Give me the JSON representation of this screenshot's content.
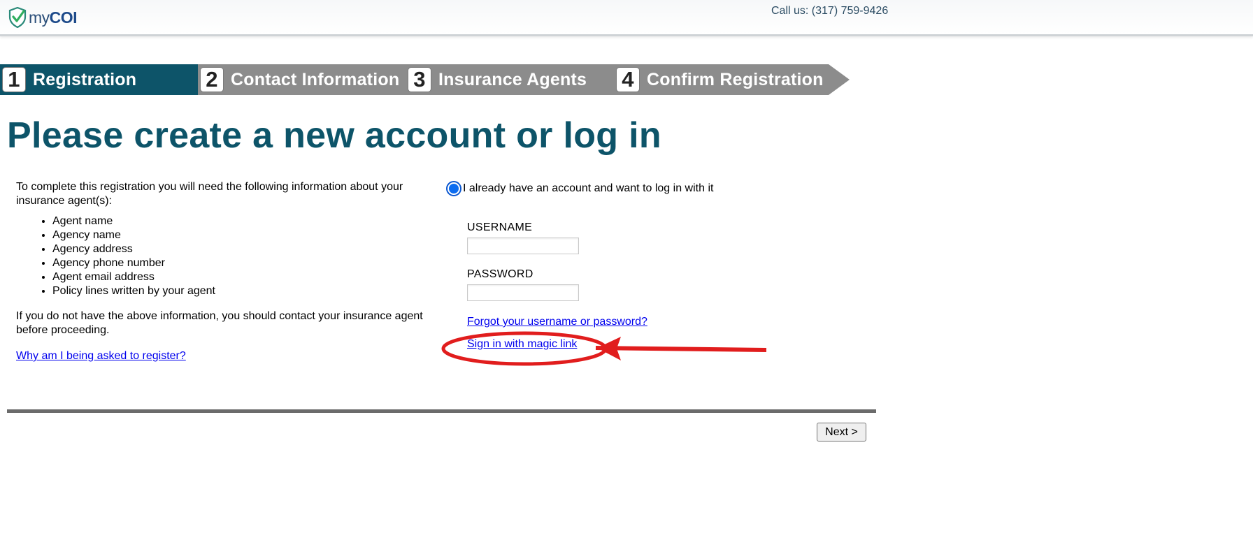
{
  "header": {
    "logo_text_light": "my",
    "logo_text_bold": "COI",
    "call_us": "Call us: (317) 759-9426"
  },
  "steps": [
    {
      "number": "1",
      "label": "Registration",
      "active": true
    },
    {
      "number": "2",
      "label": "Contact Information",
      "active": false
    },
    {
      "number": "3",
      "label": "Insurance Agents",
      "active": false
    },
    {
      "number": "4",
      "label": "Confirm Registration",
      "active": false
    }
  ],
  "colors": {
    "active_step": "#0d5469",
    "inactive_step": "#8c8c8c",
    "title": "#0d5469",
    "annotation": "#e11d1d"
  },
  "page_title": "Please create a new account or log in",
  "info": {
    "intro": "To complete this registration you will need the following information about your insurance agent(s):",
    "items": [
      "Agent name",
      "Agency name",
      "Agency address",
      "Agency phone number",
      "Agent email address",
      "Policy lines written by your agent"
    ],
    "contact_note": "If you do not have the above information, you should contact your insurance agent before proceeding.",
    "why_link": "Why am I being asked to register?"
  },
  "login": {
    "radio_label": "I already have an account and want to log in with it",
    "radio_selected": true,
    "username_label": "USERNAME",
    "username_value": "",
    "password_label": "PASSWORD",
    "password_value": "",
    "forgot_link": "Forgot your username or password?",
    "magic_link": "Sign in with magic link"
  },
  "footer": {
    "next_button": "Next >"
  }
}
